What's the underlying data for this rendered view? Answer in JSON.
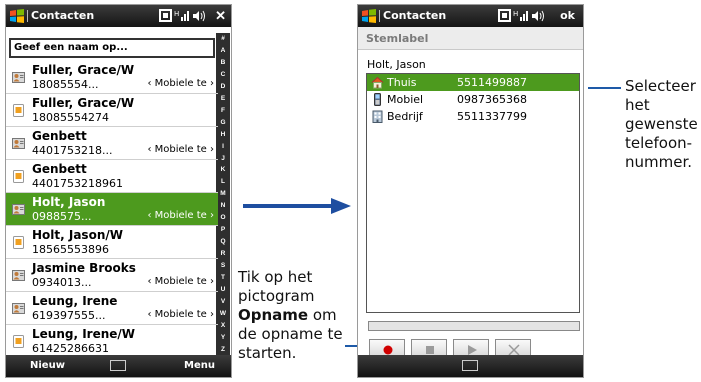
{
  "left_phone": {
    "title": "Contacten",
    "close_label": "✕",
    "search_placeholder": "Geef een naam op...",
    "alphabet": [
      "#",
      "A",
      "B",
      "C",
      "D",
      "E",
      "F",
      "G",
      "H",
      "I",
      "J",
      "K",
      "L",
      "M",
      "N",
      "O",
      "P",
      "Q",
      "R",
      "S",
      "T",
      "U",
      "V",
      "W",
      "X",
      "Y",
      "Z"
    ],
    "contacts": [
      {
        "name": "Fuller, Grace/W",
        "number": "18085554...",
        "type": "‹ Mobiele te ›",
        "icon": "contact-card-icon",
        "selected": false
      },
      {
        "name": "Fuller, Grace/W",
        "number": "18085554274",
        "type": "",
        "icon": "contact-sim-icon",
        "selected": false
      },
      {
        "name": "Genbett",
        "number": "4401753218...",
        "type": "‹ Mobiele te ›",
        "icon": "contact-card-icon",
        "selected": false
      },
      {
        "name": "Genbett",
        "number": "4401753218961",
        "type": "",
        "icon": "contact-sim-icon",
        "selected": false
      },
      {
        "name": "Holt, Jason",
        "number": "0988575...",
        "type": "‹ Mobiele te ›",
        "icon": "contact-card-icon",
        "selected": true
      },
      {
        "name": "Holt, Jason/W",
        "number": "18565553896",
        "type": "",
        "icon": "contact-sim-icon",
        "selected": false
      },
      {
        "name": "Jasmine Brooks",
        "number": "0934013...",
        "type": "‹ Mobiele te ›",
        "icon": "contact-card-icon",
        "selected": false
      },
      {
        "name": "Leung, Irene",
        "number": "619397555...",
        "type": "‹ Mobiele te ›",
        "icon": "contact-card-icon",
        "selected": false
      },
      {
        "name": "Leung, Irene/W",
        "number": "61425286631",
        "type": "",
        "icon": "contact-sim-icon",
        "selected": false
      }
    ],
    "softkey_left": "Nieuw",
    "softkey_right": "Menu"
  },
  "right_phone": {
    "title": "Contacten",
    "ok_label": "ok",
    "section_label": "Stemlabel",
    "contact_name": "Holt, Jason",
    "numbers": [
      {
        "label": "Thuis",
        "value": "5511499887",
        "icon": "home-icon",
        "selected": true
      },
      {
        "label": "Mobiel",
        "value": "0987365368",
        "icon": "mobile-icon",
        "selected": false
      },
      {
        "label": "Bedrijf",
        "value": "5511337799",
        "icon": "office-icon",
        "selected": false
      }
    ],
    "progress": 0
  },
  "annotations": {
    "left_lines": [
      "Tik op het",
      "pictogram",
      "Opname",
      " om",
      "de opname te",
      "starten."
    ],
    "right_lines": [
      "Selecteer",
      "het",
      "gewenste",
      "telefoon-",
      "nummer."
    ]
  },
  "colors": {
    "highlight": "#4d9a1e",
    "record": "#d10000",
    "leader": "#1e5aa8",
    "titlebar": "#1e1e1e"
  }
}
